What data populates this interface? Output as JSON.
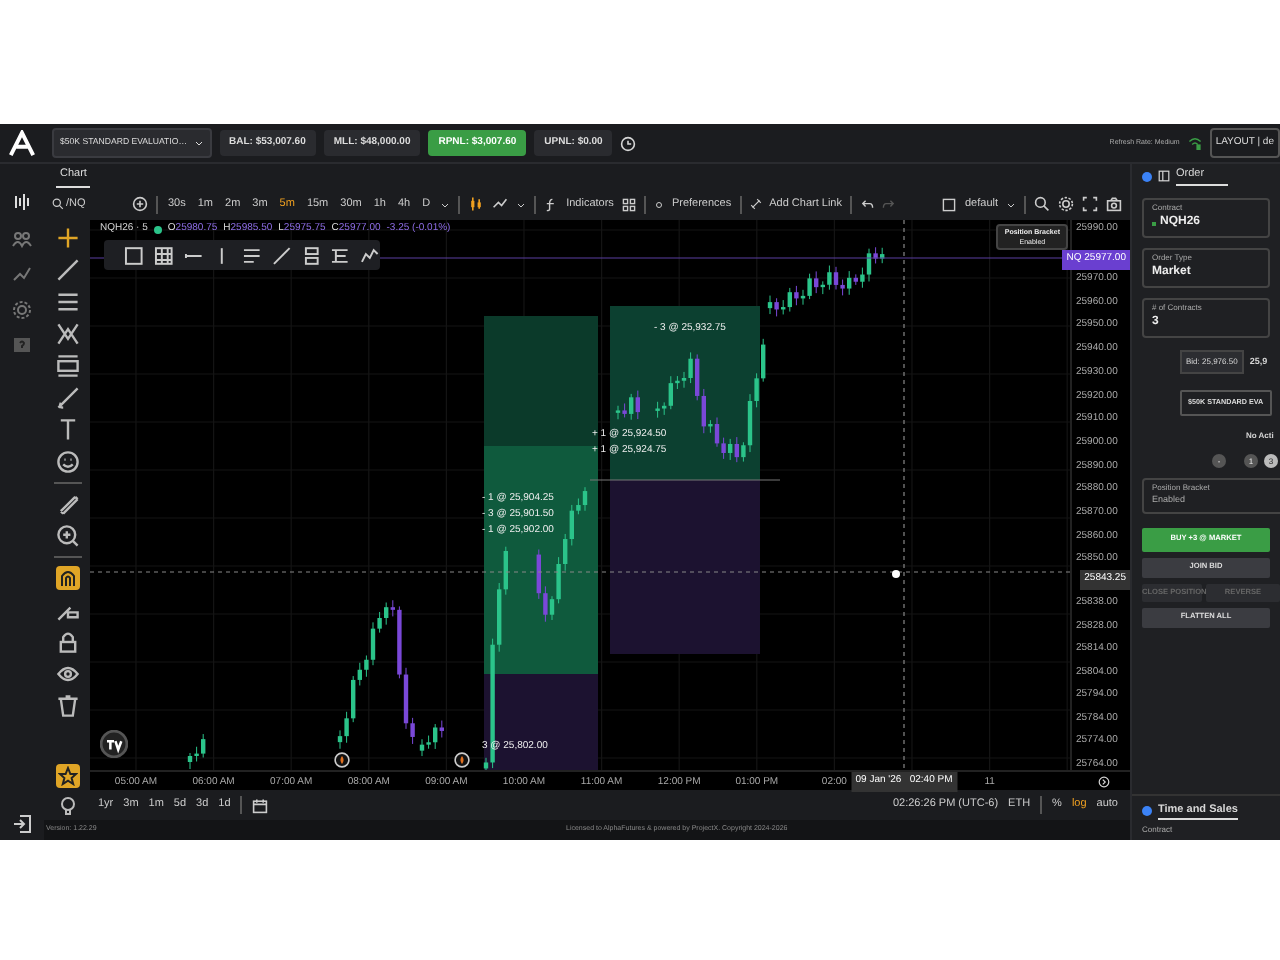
{
  "top_bar": {
    "account": "$50K STANDARD EVALUATIO…",
    "stats": [
      {
        "label": "BAL: $53,007.60",
        "kind": "plain"
      },
      {
        "label": "MLL: $48,000.00",
        "kind": "plain"
      },
      {
        "label": "RPNL: $3,007.60",
        "kind": "positive"
      },
      {
        "label": "UPNL: $0.00",
        "kind": "plain"
      }
    ],
    "refresh_rate": "Refresh Rate: Medium",
    "layout": "LAYOUT | de"
  },
  "chart_tab": {
    "label": "Chart",
    "selected": true
  },
  "toolbar": {
    "symbol": "/NQ",
    "intervals": [
      {
        "label": "30s",
        "selected": false
      },
      {
        "label": "1m",
        "selected": false
      },
      {
        "label": "2m",
        "selected": false
      },
      {
        "label": "3m",
        "selected": false
      },
      {
        "label": "5m",
        "selected": true
      },
      {
        "label": "15m",
        "selected": false
      },
      {
        "label": "30m",
        "selected": false
      },
      {
        "label": "1h",
        "selected": false
      },
      {
        "label": "4h",
        "selected": false
      },
      {
        "label": "D",
        "selected": false
      }
    ],
    "indicators": "Indicators",
    "preferences": "Preferences",
    "chart_link": "Add Chart Link",
    "template": "default"
  },
  "legend": {
    "symbol": "NQH26 · 5",
    "values": [
      {
        "label": "O",
        "value": "25980.75"
      },
      {
        "label": "H",
        "value": "25985.50"
      },
      {
        "label": "L",
        "value": "25975.75"
      },
      {
        "label": "C",
        "value": "25977.00"
      }
    ],
    "change": "-3.25 (-0.01%)"
  },
  "bracket_tip": {
    "title": "Position Bracket",
    "value": "Enabled"
  },
  "trade_labels": [
    "- 3 @ 25,932.75",
    "+ 1 @ 25,924.50",
    "+ 1 @ 25,924.75",
    "- 1 @ 25,904.25",
    "- 3 @ 25,901.50",
    "- 1 @ 25,902.00",
    "3 @ 25,802.00"
  ],
  "price_axis": [
    "25990.00",
    "25970.00",
    "25960.00",
    "25950.00",
    "25940.00",
    "25930.00",
    "25920.00",
    "25910.00",
    "25900.00",
    "25890.00",
    "25880.00",
    "25870.00",
    "25860.00",
    "25850.00",
    "25838.00",
    "25828.00",
    "25814.00",
    "25804.00",
    "25794.00",
    "25784.00",
    "25774.00",
    "25764.00"
  ],
  "last_price": {
    "symbol": "NQ",
    "price": "25977.00"
  },
  "crosshair_price": "25843.25",
  "time_axis": [
    "05:00 AM",
    "06:00 AM",
    "07:00 AM",
    "08:00 AM",
    "09:00 AM",
    "10:00 AM",
    "11:00 AM",
    "12:00 PM",
    "01:00 PM",
    "02:00",
    "11"
  ],
  "crosshair_time": "09 Jan '26   02:40 PM",
  "ranges": [
    "1yr",
    "3m",
    "1m",
    "5d",
    "3d",
    "1d"
  ],
  "clock": "02:26:26 PM (UTC-6)",
  "session": "ETH",
  "scale_options": [
    {
      "label": "%",
      "selected": false
    },
    {
      "label": "log",
      "selected": true
    },
    {
      "label": "auto",
      "selected": false
    }
  ],
  "footer": {
    "version": "Version: 1.22.29",
    "license": "Licensed to AlphaFutures & powered by ProjectX. Copyright 2024-2026"
  },
  "order_panel": {
    "tab": "Order",
    "contract_label": "Contract",
    "contract": "NQH26",
    "order_type_label": "Order Type",
    "order_type": "Market",
    "contracts_label": "# of Contracts",
    "contracts": "3",
    "bid": "Bid: 25,976.50",
    "ask": "25,9",
    "account": "$50K STANDARD EVA",
    "status": "No Acti",
    "chips": [
      {
        "label": "-",
        "selected": false
      },
      {
        "label": "1",
        "selected": false
      },
      {
        "label": "3",
        "selected": true
      }
    ],
    "bracket_label": "Position Bracket",
    "bracket": "Enabled",
    "buttons": [
      {
        "label": "BUY +3 @ MARKET",
        "kind": "buy"
      },
      {
        "label": "JOIN BID",
        "kind": "neutral"
      },
      {
        "label": "CLOSE POSITION",
        "kind": "disabled"
      },
      {
        "label": "REVERSE",
        "kind": "disabled"
      },
      {
        "label": "FLATTEN ALL",
        "kind": "neutral"
      }
    ]
  },
  "time_and_sales": {
    "title": "Time and Sales",
    "contract_label": "Contract"
  }
}
